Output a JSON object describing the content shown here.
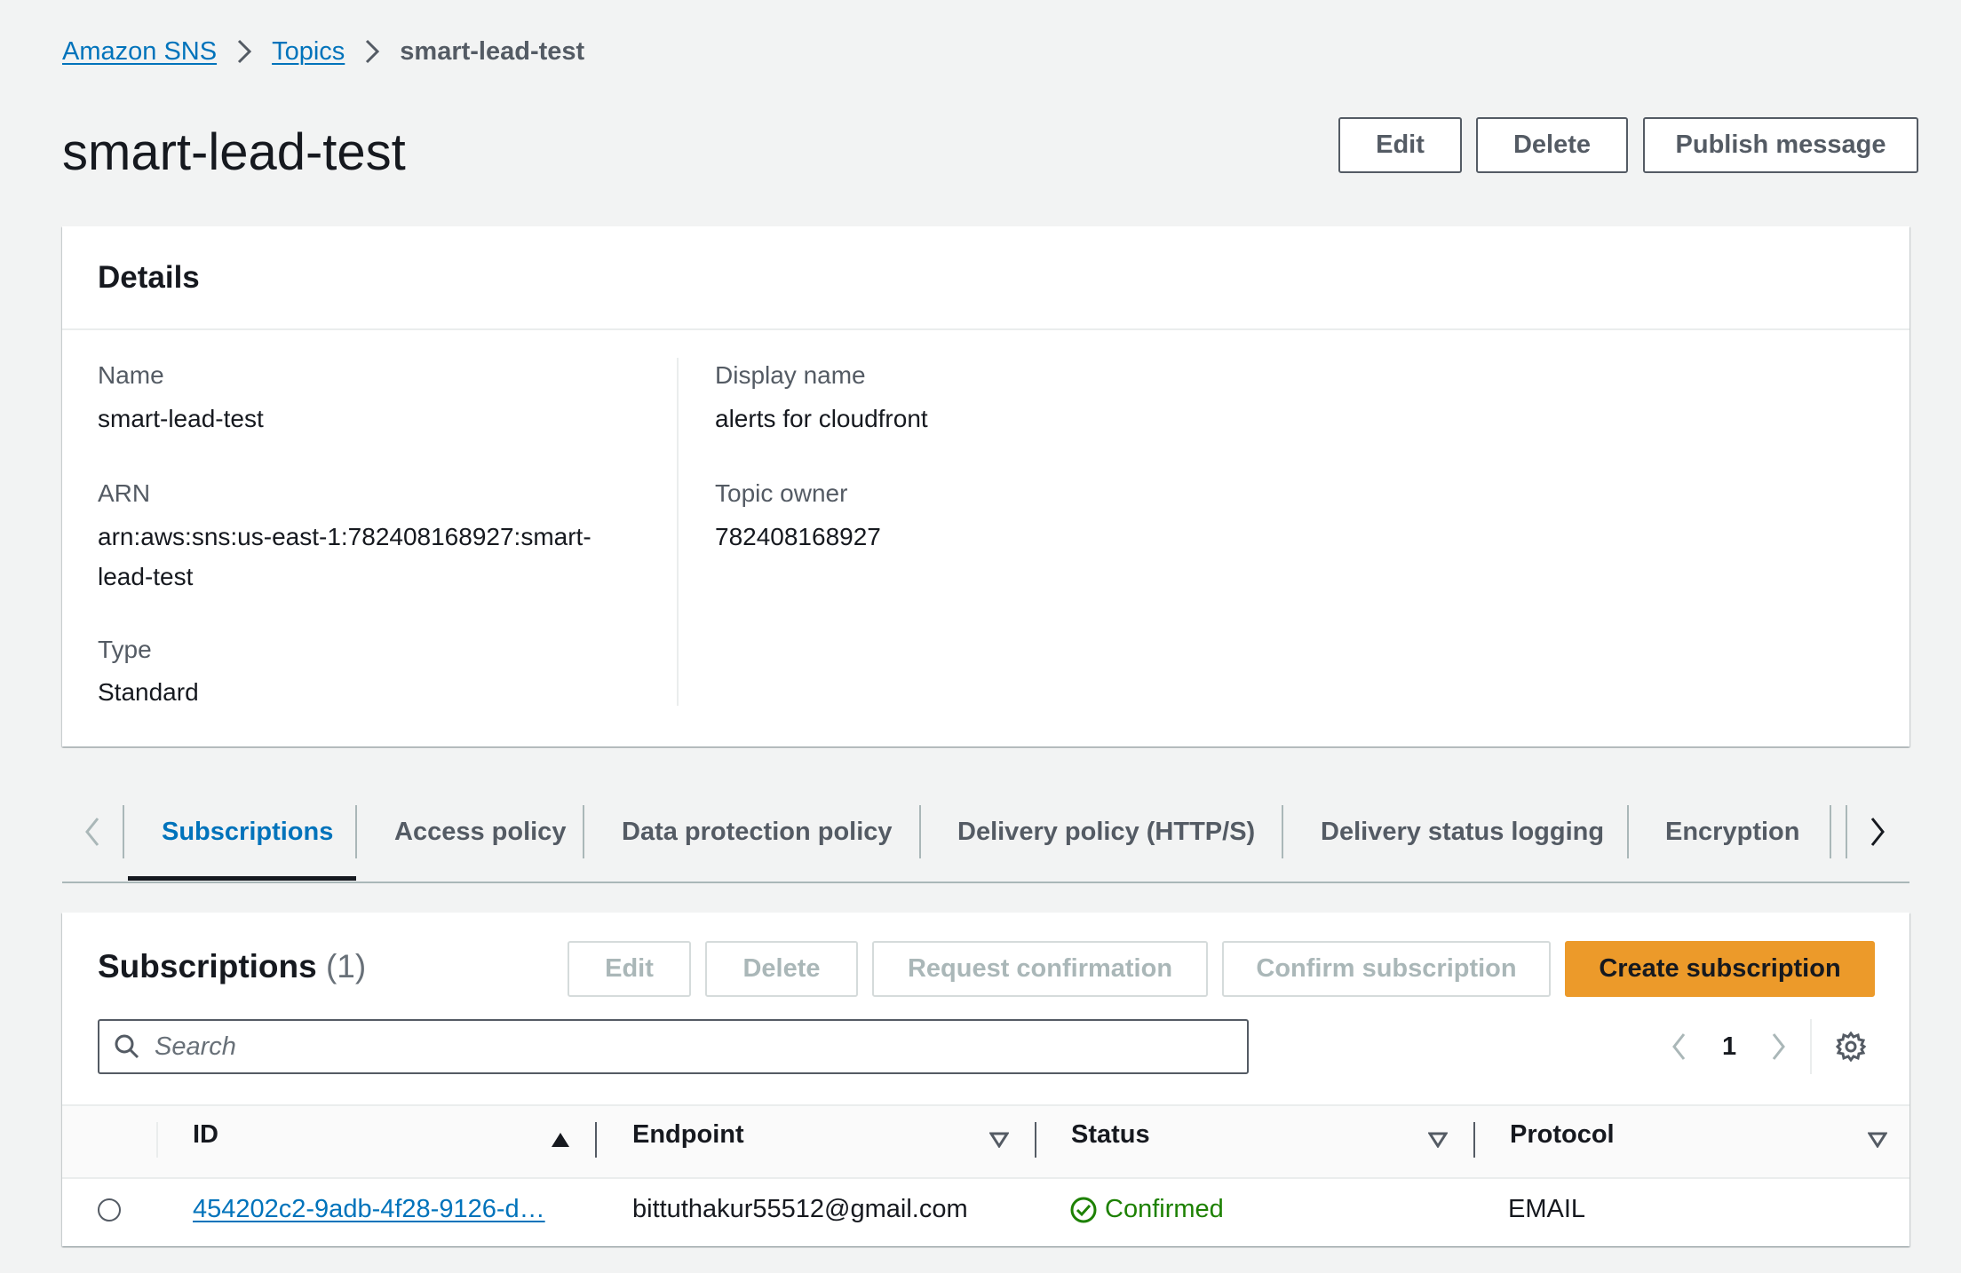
{
  "breadcrumb": {
    "root": "Amazon SNS",
    "topics": "Topics",
    "current": "smart-lead-test"
  },
  "page": {
    "title": "smart-lead-test",
    "buttons": {
      "edit": "Edit",
      "delete": "Delete",
      "publish": "Publish message"
    }
  },
  "details": {
    "title": "Details",
    "name_label": "Name",
    "name_value": "smart-lead-test",
    "arn_label": "ARN",
    "arn_line1": "arn:aws:sns:us-east-1:782408168927:smart-",
    "arn_line2": "lead-test",
    "type_label": "Type",
    "type_value": "Standard",
    "display_name_label": "Display name",
    "display_name_value": "alerts for cloudfront",
    "owner_label": "Topic owner",
    "owner_value": "782408168927"
  },
  "tabs": [
    "Subscriptions",
    "Access policy",
    "Data protection policy",
    "Delivery policy (HTTP/S)",
    "Delivery status logging",
    "Encryption"
  ],
  "subscriptions": {
    "title": "Subscriptions",
    "count": "(1)",
    "buttons": {
      "edit": "Edit",
      "delete": "Delete",
      "request": "Request confirmation",
      "confirm": "Confirm subscription",
      "create": "Create subscription"
    },
    "search_placeholder": "Search",
    "page": "1",
    "columns": [
      "ID",
      "Endpoint",
      "Status",
      "Protocol"
    ],
    "rows": [
      {
        "id": "454202c2-9adb-4f28-9126-d…",
        "endpoint": "bittuthakur55512@gmail.com",
        "status": "Confirmed",
        "protocol": "EMAIL"
      }
    ]
  },
  "colors": {
    "link": "#0073bb",
    "primary": "#ec9a2a",
    "success": "#1d8102",
    "background": "#f2f3f3"
  }
}
